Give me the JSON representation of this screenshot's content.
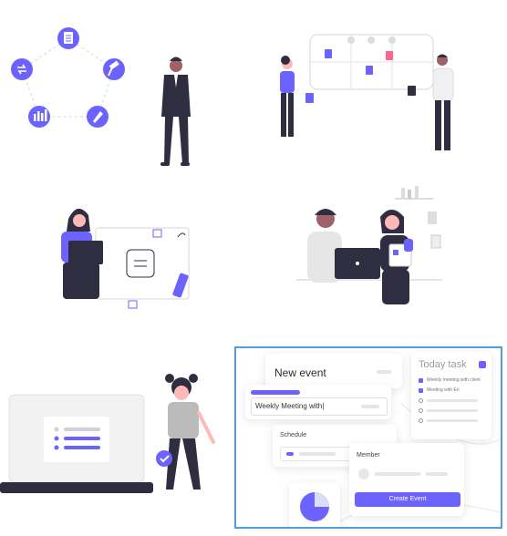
{
  "colors": {
    "accent": "#6c63ff",
    "dark": "#2f2e41",
    "skin": "#ffb8b8",
    "panel_border": "#4f9fe0"
  },
  "icons": [
    "document-icon",
    "hammer-icon",
    "rocket-icon",
    "bar-chart-icon",
    "sync-icon"
  ],
  "event_panel": {
    "title": "New event",
    "name_input_value": "Weekly Meeting with|",
    "schedule_label": "Schedule",
    "member_label": "Member",
    "create_button": "Create Event"
  },
  "task_panel": {
    "title": "Today task",
    "tasks": [
      {
        "label": "Weekly meeting with client",
        "checked": true
      },
      {
        "label": "Meeting with Eri",
        "checked": true
      },
      {
        "label": "",
        "checked": false
      },
      {
        "label": "",
        "checked": false
      },
      {
        "label": "",
        "checked": false
      }
    ]
  }
}
